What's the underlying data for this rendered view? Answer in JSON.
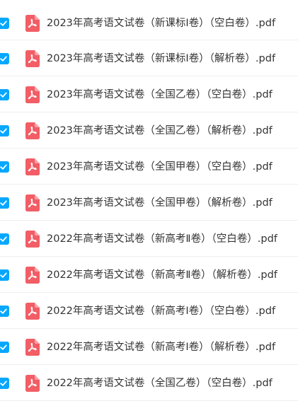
{
  "colors": {
    "checkbox": "#06a7ff",
    "pdf_icon": "#f25d66",
    "text": "#333333",
    "divider": "#eeeeee"
  },
  "icons": {
    "checkbox": "check-icon",
    "file": "pdf-icon"
  },
  "files": [
    {
      "name": "2023年高考语文试卷（新课标Ⅰ卷）（空白卷）.pdf",
      "selected": true
    },
    {
      "name": "2023年高考语文试卷（新课标Ⅰ卷）（解析卷）.pdf",
      "selected": true
    },
    {
      "name": "2023年高考语文试卷（全国乙卷）（空白卷）.pdf",
      "selected": true
    },
    {
      "name": "2023年高考语文试卷（全国乙卷）（解析卷）.pdf",
      "selected": true
    },
    {
      "name": "2023年高考语文试卷（全国甲卷）（空白卷）.pdf",
      "selected": true
    },
    {
      "name": "2023年高考语文试卷（全国甲卷）（解析卷）.pdf",
      "selected": true
    },
    {
      "name": "2022年高考语文试卷（新高考Ⅱ卷）（空白卷）.pdf",
      "selected": true
    },
    {
      "name": "2022年高考语文试卷（新高考Ⅱ卷）（解析卷）.pdf",
      "selected": true
    },
    {
      "name": "2022年高考语文试卷（新高考Ⅰ卷）（空白卷）.pdf",
      "selected": true
    },
    {
      "name": "2022年高考语文试卷（新高考Ⅰ卷）（解析卷）.pdf",
      "selected": true
    },
    {
      "name": "2022年高考语文试卷（全国乙卷）（空白卷）.pdf",
      "selected": true
    }
  ]
}
